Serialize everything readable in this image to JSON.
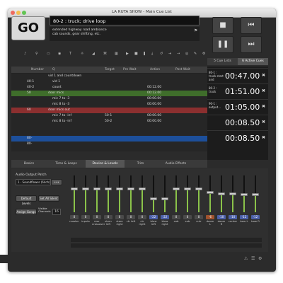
{
  "window": {
    "title": "LA RUTA SHOW - Main Cue List"
  },
  "go_label": "GO",
  "standby": {
    "cue": "80-2 : truck; drive loop",
    "notes": [
      "extended highway road ambiance",
      "cab sounds, gear shifting, etc."
    ]
  },
  "transport": {
    "stop_icon": "stop-icon",
    "prev_icon": "previous-cue-icon",
    "pause_icon": "pause-icon",
    "next_icon": "next-cue-icon"
  },
  "right_tabs": [
    "5 Cue Lists",
    "6 Active Cues"
  ],
  "table": {
    "headers": [
      "Number",
      "Q",
      "Target",
      "Pre Wait",
      "Action",
      "Post Wait"
    ],
    "rows": [
      {
        "number": "",
        "name": "vid 1 and countdown",
        "target": "",
        "pre": "",
        "action": "",
        "post": "",
        "color": ""
      },
      {
        "number": "40-1",
        "name": "vid 1",
        "target": "",
        "pre": "",
        "action": "",
        "post": "",
        "color": ""
      },
      {
        "number": "40-2",
        "name": "count",
        "target": "",
        "pre": "",
        "action": "00:12.00",
        "post": "",
        "color": ""
      },
      {
        "number": "50",
        "name": "door mics",
        "target": "",
        "pre": "",
        "action": "00:12.00",
        "post": "",
        "color": "#3f6e2b"
      },
      {
        "number": "",
        "name": "mic 7 to -3",
        "target": "",
        "pre": "",
        "action": "00:00.00",
        "post": "",
        "color": ""
      },
      {
        "number": "",
        "name": "mic 8 to -3",
        "target": "",
        "pre": "",
        "action": "00:00.00",
        "post": "",
        "color": ""
      },
      {
        "number": "60",
        "name": "door mics out",
        "target": "",
        "pre": "",
        "action": "",
        "post": "",
        "color": "#8b2f2f"
      },
      {
        "number": "",
        "name": "mic 7 to -inf",
        "target": "50-1",
        "pre": "",
        "action": "00:00.00",
        "post": "",
        "color": ""
      },
      {
        "number": "",
        "name": "mic 8 to -inf",
        "target": "50-2",
        "pre": "",
        "action": "00:00.00",
        "post": "",
        "color": ""
      },
      {
        "number": "",
        "name": "",
        "target": "",
        "pre": "",
        "action": "",
        "post": "",
        "color": ""
      },
      {
        "number": "",
        "name": "",
        "target": "",
        "pre": "",
        "action": "",
        "post": "",
        "color": ""
      },
      {
        "number": "80-",
        "name": "",
        "target": "",
        "pre": "",
        "action": "",
        "post": "",
        "color": "#1d4f9a"
      },
      {
        "number": "80-",
        "name": "",
        "target": "",
        "pre": "",
        "action": "",
        "post": "",
        "color": ""
      }
    ]
  },
  "active_cues": [
    {
      "name": "80-1 : truck start and",
      "time": "00:47.00"
    },
    {
      "name": "80-2 : truck",
      "time": "01:51.00"
    },
    {
      "name": "90-1 : output...",
      "time": "01:05.00"
    },
    {
      "name": "",
      "time": "00:08.50"
    },
    {
      "name": "",
      "time": "00:08.50"
    }
  ],
  "inspector_tabs": [
    "Basics",
    "Time & Loops",
    "Device & Levels",
    "Trim",
    "Audio Effects"
  ],
  "device": {
    "patch_label": "Audio Output Patch",
    "patch_value": "1 - Soundflower (64ch)",
    "default_levels": "Default Levels",
    "set_all_silent": "Set All Silent",
    "assign_gangs": "Assign Gangs",
    "visible_channels_label": "Visible Channels",
    "visible_channels_value": "16"
  },
  "channels": [
    {
      "name": "master",
      "level": "0",
      "pos": 0.35
    },
    {
      "name": "inputs",
      "level": "0",
      "pos": 0.35
    },
    {
      "name": "rear crossover",
      "level": "0",
      "pos": 0.35
    },
    {
      "name": "stem left",
      "level": "0",
      "pos": 0.35
    },
    {
      "name": "stem right",
      "level": "0",
      "pos": 0.35
    },
    {
      "name": "ctr left",
      "level": "0",
      "pos": 0.35
    },
    {
      "name": "ctr right",
      "level": "0",
      "pos": 0.35
    },
    {
      "name": "blow left",
      "level": "-22",
      "pos": 0.65
    },
    {
      "name": "blow right",
      "level": "-22",
      "pos": 0.65
    },
    {
      "name": "cab",
      "level": "0",
      "pos": 0.35
    },
    {
      "name": "sub",
      "level": "0",
      "pos": 0.35
    },
    {
      "name": "cutr",
      "level": "0",
      "pos": 0.35
    },
    {
      "name": "doom L",
      "level": "-6",
      "pos": 0.45
    },
    {
      "name": "doom R",
      "level": "-10",
      "pos": 0.5
    },
    {
      "name": "center",
      "level": "-10",
      "pos": 0.5
    },
    {
      "name": "bow L",
      "level": "-12",
      "pos": 0.52
    },
    {
      "name": "bow R",
      "level": "-12",
      "pos": 0.52
    }
  ],
  "colors": {
    "accent_green": "#8bc34a",
    "blue": "#1d4f9a",
    "red": "#8b2f2f",
    "green_row": "#3f6e2b"
  }
}
